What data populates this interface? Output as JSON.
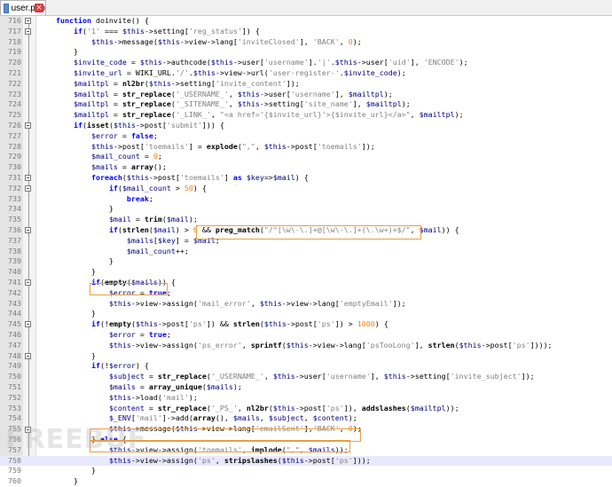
{
  "tab": {
    "label": "user.php"
  },
  "watermark": "FREEBUF",
  "lines": [
    {
      "n": "716",
      "code": "    function doinvite() {"
    },
    {
      "n": "717",
      "code": "        if('1' === $this->setting['reg_status']) {"
    },
    {
      "n": "718",
      "code": "            $this->message($this->view->lang['inviteClosed'], 'BACK', 0);"
    },
    {
      "n": "719",
      "code": "        }"
    },
    {
      "n": "720",
      "code": "        $invite_code = $this->authcode($this->user['username'].'|'.$this->user['uid'], 'ENCODE');"
    },
    {
      "n": "721",
      "code": "        $invite_url = WIKI_URL.'/'.$this->view->url('user-register-'.$invite_code);"
    },
    {
      "n": "722",
      "code": "        $mailtpl = nl2br($this->setting['invite_content']);"
    },
    {
      "n": "723",
      "code": "        $mailtpl = str_replace('_USERNAME_', $this->user['username'], $mailtpl);"
    },
    {
      "n": "724",
      "code": "        $mailtpl = str_replace('_SITENAME_', $this->setting['site_name'], $mailtpl);"
    },
    {
      "n": "725",
      "code": "        $mailtpl = str_replace('_LINK_', \"<a href='{$invite_url}'>{$invite_url}</a>\", $mailtpl);"
    },
    {
      "n": "726",
      "code": "        if(isset($this->post['submit'])) {"
    },
    {
      "n": "727",
      "code": "            $error = false;"
    },
    {
      "n": "728",
      "code": "            $this->post['toemails'] = explode(\",\", $this->post['toemails']);"
    },
    {
      "n": "729",
      "code": "            $mail_count = 0;"
    },
    {
      "n": "730",
      "code": "            $mails = array();"
    },
    {
      "n": "731",
      "code": "            foreach($this->post['toemails'] as $key=>$mail) {"
    },
    {
      "n": "732",
      "code": "                if($mail_count > 50) {"
    },
    {
      "n": "733",
      "code": "                    break;"
    },
    {
      "n": "734",
      "code": "                }"
    },
    {
      "n": "735",
      "code": "                $mail = trim($mail);"
    },
    {
      "n": "736",
      "code": "                if(strlen($mail) > 6 && preg_match(\"/^[\\w\\-\\.]+@[\\w\\-\\.]+(\\.\\w+)+$/\", $mail)) {"
    },
    {
      "n": "737",
      "code": "                    $mails[$key] = $mail;"
    },
    {
      "n": "738",
      "code": "                    $mail_count++;"
    },
    {
      "n": "739",
      "code": "                }"
    },
    {
      "n": "740",
      "code": "            }"
    },
    {
      "n": "741",
      "code": "            if(empty($mails)) {"
    },
    {
      "n": "742",
      "code": "                $error = true;"
    },
    {
      "n": "743",
      "code": "                $this->view->assign('mail_error', $this->view->lang['emptyEmail']);"
    },
    {
      "n": "744",
      "code": "            }"
    },
    {
      "n": "745",
      "code": "            if(!empty($this->post['ps']) && strlen($this->post['ps']) > 1000) {"
    },
    {
      "n": "746",
      "code": "                $error = true;"
    },
    {
      "n": "747",
      "code": "                $this->view->assign('ps_error', sprintf($this->view->lang['psTooLong'], strlen($this->post['ps'])));"
    },
    {
      "n": "748",
      "code": "            }"
    },
    {
      "n": "749",
      "code": "            if(!$error) {"
    },
    {
      "n": "750",
      "code": "                $subject = str_replace('_USERNAME_', $this->user['username'], $this->setting['invite_subject']);"
    },
    {
      "n": "751",
      "code": "                $mails = array_unique($mails);"
    },
    {
      "n": "752",
      "code": "                $this->load('mail');"
    },
    {
      "n": "753",
      "code": "                $content = str_replace('_PS_', nl2br($this->post['ps']), addslashes($mailtpl));"
    },
    {
      "n": "754",
      "code": "                $_ENV['mail']->add(array(), $mails, $subject, $content);"
    },
    {
      "n": "755",
      "code": "                $this->message($this->view->lang['emailSent'],'BACK', 0);"
    },
    {
      "n": "756",
      "code": "            } else {"
    },
    {
      "n": "757",
      "code": "                $this->view->assign('toemails', implode(\",\", $mails));"
    },
    {
      "n": "758",
      "code": "                $this->view->assign('ps', stripslashes($this->post['ps']));"
    },
    {
      "n": "759",
      "code": "            }"
    },
    {
      "n": "760",
      "code": "        }"
    }
  ],
  "colors": {
    "keyword": "#0000ff",
    "string": "#808080",
    "number": "#ff8000",
    "highlight_box": "#e8a040",
    "current_line": "#e8e8ff"
  }
}
